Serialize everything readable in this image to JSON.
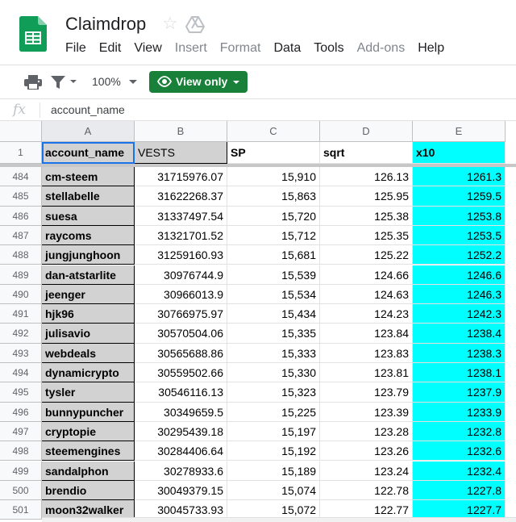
{
  "app": {
    "doc_title": "Claimdrop",
    "menu": [
      {
        "label": "File",
        "enabled": true
      },
      {
        "label": "Edit",
        "enabled": true
      },
      {
        "label": "View",
        "enabled": true
      },
      {
        "label": "Insert",
        "enabled": false
      },
      {
        "label": "Format",
        "enabled": false
      },
      {
        "label": "Data",
        "enabled": true
      },
      {
        "label": "Tools",
        "enabled": true
      },
      {
        "label": "Add-ons",
        "enabled": false
      },
      {
        "label": "Help",
        "enabled": true
      }
    ],
    "brand_color": "#0f9d58"
  },
  "toolbar": {
    "zoom": "100%",
    "view_only_label": "View only",
    "view_only_color": "#188038"
  },
  "formula_bar": {
    "fx_label": "fx",
    "content": "account_name"
  },
  "grid": {
    "columns": [
      "A",
      "B",
      "C",
      "D",
      "E"
    ],
    "header_row": {
      "row_number": "1",
      "cells": [
        "account_name",
        "VESTS",
        "SP",
        "sqrt",
        "x10"
      ]
    },
    "rows": [
      {
        "n": "484",
        "account_name": "cm-steem",
        "vests": "31715976.07",
        "sp": "15,910",
        "sqrt": "126.13",
        "x10": "1261.3"
      },
      {
        "n": "485",
        "account_name": "stellabelle",
        "vests": "31622268.37",
        "sp": "15,863",
        "sqrt": "125.95",
        "x10": "1259.5"
      },
      {
        "n": "486",
        "account_name": "suesa",
        "vests": "31337497.54",
        "sp": "15,720",
        "sqrt": "125.38",
        "x10": "1253.8"
      },
      {
        "n": "487",
        "account_name": "raycoms",
        "vests": "31321701.52",
        "sp": "15,712",
        "sqrt": "125.35",
        "x10": "1253.5"
      },
      {
        "n": "488",
        "account_name": "jungjunghoon",
        "vests": "31259160.93",
        "sp": "15,681",
        "sqrt": "125.22",
        "x10": "1252.2"
      },
      {
        "n": "489",
        "account_name": "dan-atstarlite",
        "vests": "30976744.9",
        "sp": "15,539",
        "sqrt": "124.66",
        "x10": "1246.6"
      },
      {
        "n": "490",
        "account_name": "jeenger",
        "vests": "30966013.9",
        "sp": "15,534",
        "sqrt": "124.63",
        "x10": "1246.3"
      },
      {
        "n": "491",
        "account_name": "hjk96",
        "vests": "30766975.97",
        "sp": "15,434",
        "sqrt": "124.23",
        "x10": "1242.3"
      },
      {
        "n": "492",
        "account_name": "julisavio",
        "vests": "30570504.06",
        "sp": "15,335",
        "sqrt": "123.84",
        "x10": "1238.4"
      },
      {
        "n": "493",
        "account_name": "webdeals",
        "vests": "30565688.86",
        "sp": "15,333",
        "sqrt": "123.83",
        "x10": "1238.3"
      },
      {
        "n": "494",
        "account_name": "dynamicrypto",
        "vests": "30559502.66",
        "sp": "15,330",
        "sqrt": "123.81",
        "x10": "1238.1"
      },
      {
        "n": "495",
        "account_name": "tysler",
        "vests": "30546116.13",
        "sp": "15,323",
        "sqrt": "123.79",
        "x10": "1237.9"
      },
      {
        "n": "496",
        "account_name": "bunnypuncher",
        "vests": "30349659.5",
        "sp": "15,225",
        "sqrt": "123.39",
        "x10": "1233.9"
      },
      {
        "n": "497",
        "account_name": "cryptopie",
        "vests": "30295439.18",
        "sp": "15,197",
        "sqrt": "123.28",
        "x10": "1232.8"
      },
      {
        "n": "498",
        "account_name": "steemengines",
        "vests": "30284406.64",
        "sp": "15,192",
        "sqrt": "123.26",
        "x10": "1232.6"
      },
      {
        "n": "499",
        "account_name": "sandalphon",
        "vests": "30278933.6",
        "sp": "15,189",
        "sqrt": "123.24",
        "x10": "1232.4"
      },
      {
        "n": "500",
        "account_name": "brendio",
        "vests": "30049379.15",
        "sp": "15,074",
        "sqrt": "122.78",
        "x10": "1227.8"
      },
      {
        "n": "501",
        "account_name": "moon32walker",
        "vests": "30045733.93",
        "sp": "15,072",
        "sqrt": "122.77",
        "x10": "1227.7"
      }
    ],
    "colors": {
      "account_name_fill": "#d2d2d2",
      "x10_fill": "#00ffff",
      "active_cell_border": "#1a73e8"
    }
  }
}
